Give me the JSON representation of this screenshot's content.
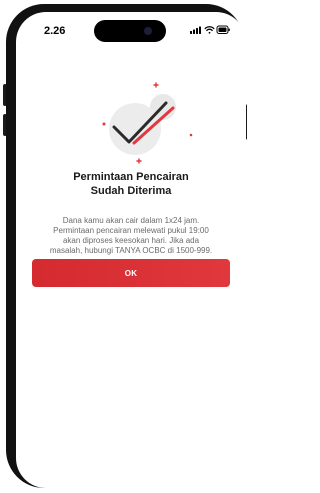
{
  "status_bar": {
    "time": "2.26",
    "icons": [
      "signal-icon",
      "wifi-icon",
      "battery-icon"
    ]
  },
  "illustration": {
    "icon": "success-check-icon",
    "colors": {
      "check": "#2b2b2b",
      "accent": "#e0383d",
      "circle": "#e8e8e8"
    }
  },
  "dialog": {
    "title_line1": "Permintaan Pencairan",
    "title_line2": "Sudah Diterima",
    "desc_line1": "Dana kamu akan cair dalam 1x24 jam.",
    "desc_line2": "Permintaan pencairan melewati pukul 19:00",
    "desc_line3": "akan diproses keesokan hari. Jika ada",
    "desc_line4": "masalah, hubungi TANYA OCBC di 1500-999.",
    "ok_label": "OK"
  },
  "colors": {
    "brand": "#e0383d",
    "title": "#1a1a1a",
    "body_text": "#6b6b6b"
  }
}
